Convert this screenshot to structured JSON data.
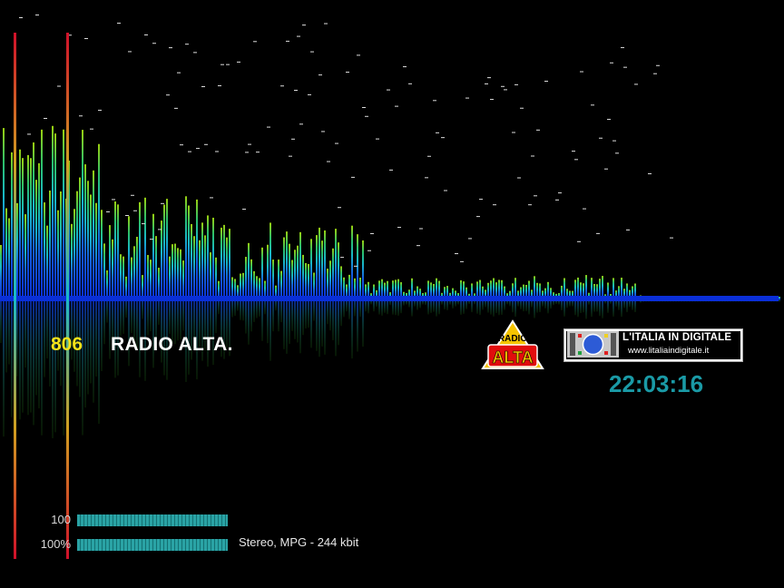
{
  "station": {
    "channel_number": "806",
    "name": "RADIO ALTA."
  },
  "clock": {
    "time": "22:03:16"
  },
  "volume": {
    "label": "100",
    "level": 1.0
  },
  "balance": {
    "label": "100%",
    "level": 1.0
  },
  "stream": {
    "info": "Stereo, MPG - 244 kbit"
  },
  "logos": {
    "radio_alta": {
      "top_text": "RADIO",
      "main_text": "ALTA"
    },
    "italia_digitale": {
      "title": "L'ITALIA IN DIGITALE",
      "url": "www.litaliaindigitale.it"
    }
  },
  "colors": {
    "background": "#000000",
    "channel_number": "#f3e21a",
    "station_name": "#ffffff",
    "clock": "#1a9aa6",
    "waveform_base": "#0a2fd8",
    "waveform_high": "#8fcf18",
    "level_bar": "#1f8a8c"
  }
}
